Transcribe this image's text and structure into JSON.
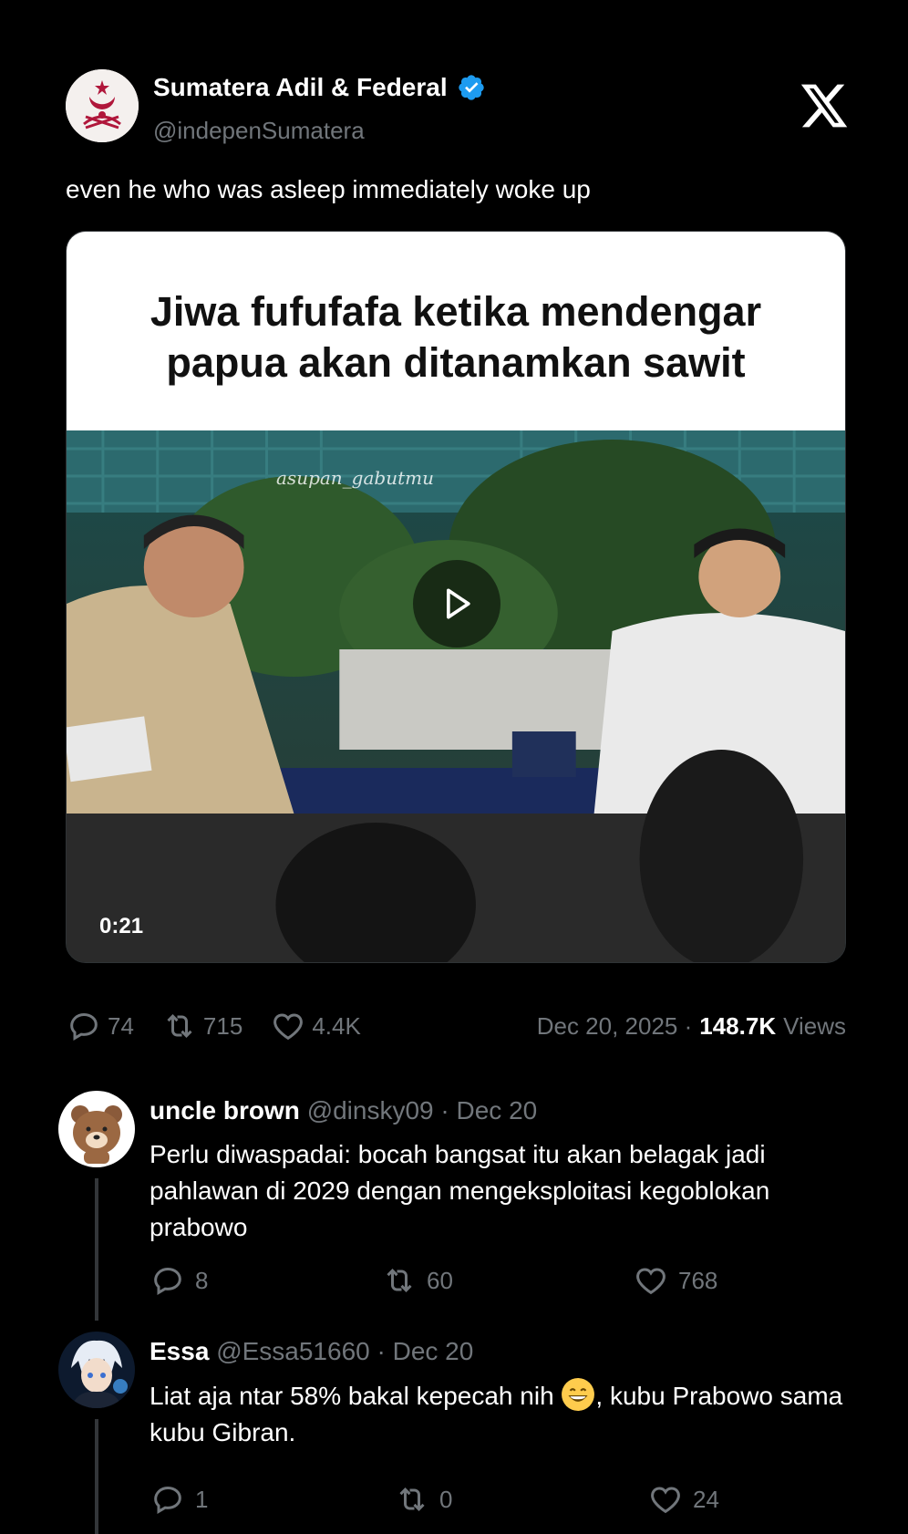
{
  "tweet": {
    "display_name": "Sumatera Adil & Federal",
    "handle": "@indepenSumatera",
    "text": "even he who was asleep immediately woke up",
    "media": {
      "caption_line1": "Jiwa fufufafa ketika mendengar",
      "caption_line2": "papua akan ditanamkan sawit",
      "watermark": "asupan_gabutmu",
      "duration": "0:21"
    },
    "stats": {
      "replies": "74",
      "reposts": "715",
      "likes": "4.4K",
      "date": "Dec 20, 2025 ·",
      "views_count": "148.7K",
      "views_label": "Views"
    }
  },
  "replies": [
    {
      "name": "uncle brown",
      "meta": "@dinsky09 · Dec 20",
      "text": "Perlu diwaspadai: bocah bangsat itu akan belagak jadi pahlawan di 2029 dengan mengeksploitasi kegoblokan prabowo",
      "replies": "8",
      "reposts": "60",
      "likes": "768"
    },
    {
      "name": "Essa",
      "meta": "@Essa51660 · Dec 20",
      "text_before_emoji": "Liat aja ntar 58% bakal kepecah nih",
      "text_after_emoji": ", kubu Prabowo sama kubu Gibran.",
      "replies": "1",
      "reposts": "0",
      "likes": "24"
    }
  ],
  "colors": {
    "background": "#000000",
    "secondary_text": "#71767b",
    "verified_blue": "#1d9bf0"
  }
}
